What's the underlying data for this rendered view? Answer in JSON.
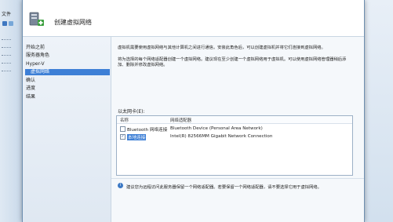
{
  "background_app": {
    "menu_label": "文件"
  },
  "dialog": {
    "title": "创建虚拟网络"
  },
  "nav": {
    "items": [
      {
        "label": "开始之前"
      },
      {
        "label": "服务器角色"
      },
      {
        "label": "Hyper-V"
      },
      {
        "label": "虚拟网络"
      },
      {
        "label": "确认"
      },
      {
        "label": "进度"
      },
      {
        "label": "结果"
      }
    ]
  },
  "content": {
    "paragraph1": "虚拟机需要使用虚拟网络与其他计算机之间进行通信。安装此角色后，可以创建虚拟机并将它们连接到虚拟网络。",
    "paragraph2": "将为选择的每个网络适配器创建一个虚拟网络。建议现在至少创建一个虚拟网络用于虚拟机。可以使用虚拟网络管理器稍后添加、删除并修改虚拟网络。",
    "list_label": "以太网卡(E):",
    "columns": {
      "name": "名称",
      "adapter": "网络适配器"
    },
    "rows": [
      {
        "name": "Bluetooth 网络连接",
        "adapter": "Bluetooth Device (Personal Area Network)",
        "checked": false
      },
      {
        "name": "本地连接",
        "adapter": "Intel(R) 82566MM Gigabit Network Connection",
        "checked": true
      }
    ],
    "info": "建议您为远程访问此服务器保留一个网络适配器。若要保留一个网络适配器，请不要选择它用于虚拟网络。"
  }
}
